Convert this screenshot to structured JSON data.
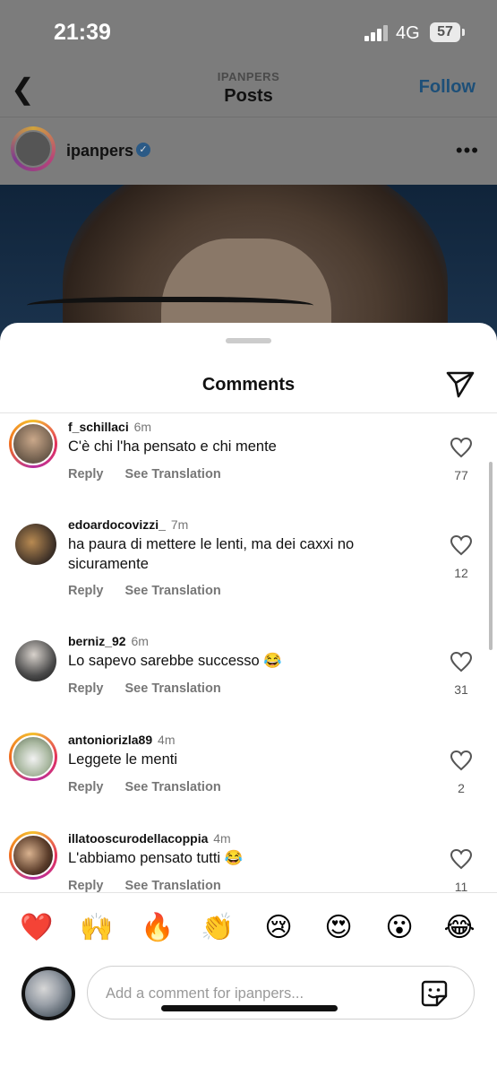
{
  "status": {
    "time": "21:39",
    "network": "4G",
    "battery": "57"
  },
  "nav": {
    "account_caps": "IPANPERS",
    "title": "Posts",
    "follow_label": "Follow"
  },
  "post": {
    "username": "ipanpers"
  },
  "sheet": {
    "title": "Comments"
  },
  "comments": [
    {
      "username": "f_schillaci",
      "time": "6m",
      "text": "C'è chi l'ha pensato e chi mente",
      "reply": "Reply",
      "translate": "See Translation",
      "likes": "77"
    },
    {
      "username": "edoardocovizzi_",
      "time": "7m",
      "text": "ha paura di mettere le lenti, ma dei caxxi no sicuramente",
      "reply": "Reply",
      "translate": "See Translation",
      "likes": "12"
    },
    {
      "username": "berniz_92",
      "time": "6m",
      "text": "Lo sapevo sarebbe successo 😂",
      "reply": "Reply",
      "translate": "See Translation",
      "likes": "31"
    },
    {
      "username": "antoniorizla89",
      "time": "4m",
      "text": "Leggete le menti",
      "reply": "Reply",
      "translate": "See Translation",
      "likes": "2"
    },
    {
      "username": "illatooscurodellacoppia",
      "time": "4m",
      "text": "L'abbiamo pensato tutti 😂",
      "reply": "Reply",
      "translate": "See Translation",
      "likes": "11"
    }
  ],
  "emojis": [
    "❤️",
    "🙌",
    "🔥",
    "👏",
    "😢",
    "😍",
    "😮",
    "😂"
  ],
  "composer": {
    "placeholder": "Add a comment for ipanpers..."
  },
  "colors": {
    "accent": "#1d4f78",
    "verified": "#2b5a86",
    "ring": "#e3325c"
  }
}
